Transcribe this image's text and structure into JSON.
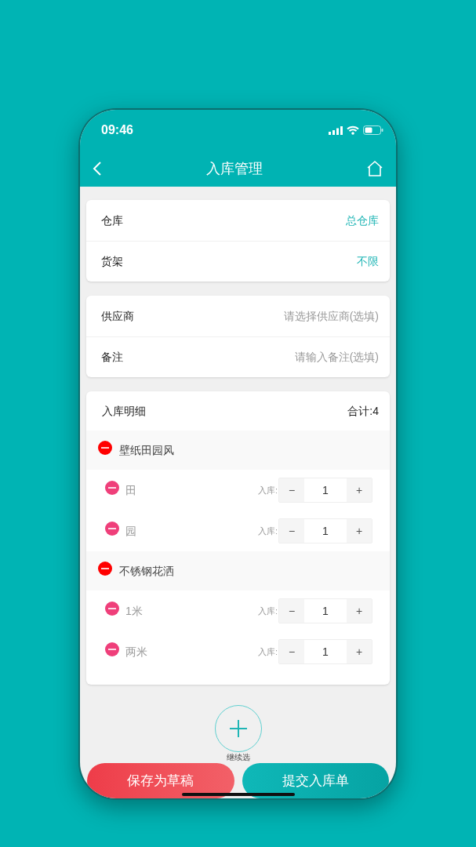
{
  "status_bar": {
    "time": "09:46"
  },
  "header": {
    "title": "入库管理"
  },
  "location_rows": [
    {
      "label": "仓库",
      "value": "总仓库"
    },
    {
      "label": "货架",
      "value": "不限"
    }
  ],
  "form_fields": [
    {
      "label": "供应商",
      "placeholder": "请选择供应商(选填)"
    },
    {
      "label": "备注",
      "placeholder": "请输入备注(选填)"
    }
  ],
  "details": {
    "title": "入库明细",
    "total": "合计:4",
    "groups": [
      {
        "name": "壁纸田园风",
        "items": [
          {
            "name": "田",
            "label": "入库:",
            "minus": "−",
            "quantity": "1",
            "plus": "+"
          },
          {
            "name": "园",
            "label": "入库:",
            "minus": "−",
            "quantity": "1",
            "plus": "+"
          }
        ]
      },
      {
        "name": "不锈钢花洒",
        "items": [
          {
            "name": "1米",
            "label": "入库:",
            "minus": "−",
            "quantity": "1",
            "plus": "+"
          },
          {
            "name": "两米",
            "label": "入库:",
            "minus": "−",
            "quantity": "1",
            "plus": "+"
          }
        ]
      }
    ]
  },
  "add_button": {
    "label": "继续选"
  },
  "buttons": [
    {
      "kind": "draft",
      "label": "保存为草稿"
    },
    {
      "kind": "submit",
      "label": "提交入库单"
    }
  ]
}
